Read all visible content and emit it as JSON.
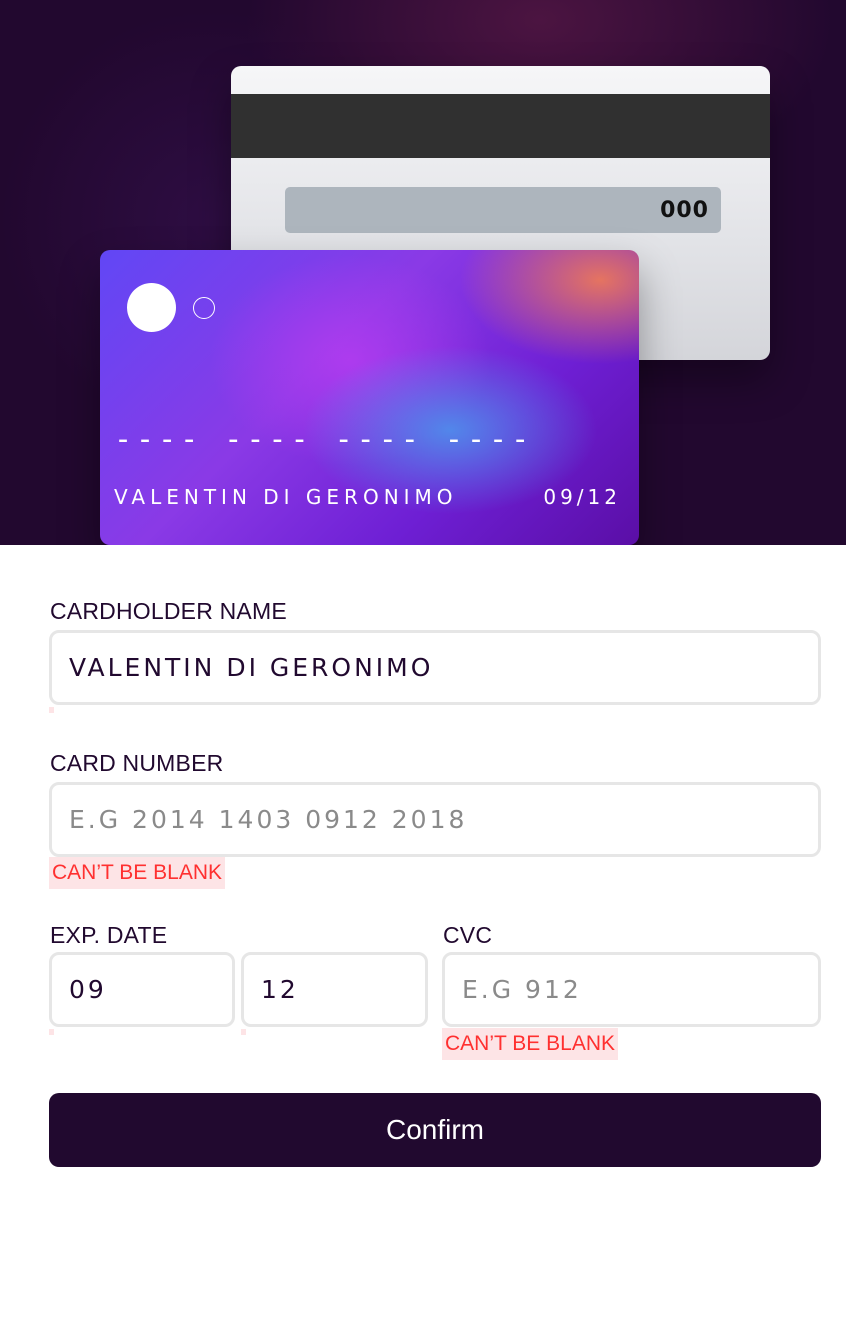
{
  "card": {
    "back": {
      "cvc": "000"
    },
    "front": {
      "number": "---- ---- ---- ----",
      "holder": "VALENTIN DI GERONIMO",
      "expiry": "09/12"
    }
  },
  "form": {
    "cardholder": {
      "label": "CARDHOLDER NAME",
      "value": "VALENTIN DI GERONIMO"
    },
    "number": {
      "label": "CARD NUMBER",
      "value": "",
      "placeholder": "E.G 2014 1403 0912 2018",
      "error": "CAN’T BE BLANK"
    },
    "expiry": {
      "label": "EXP. DATE",
      "month": "09",
      "year": "12"
    },
    "cvc": {
      "label": "CVC",
      "value": "",
      "placeholder": "E.G 912",
      "error": "CAN’T BE BLANK"
    },
    "confirm_label": "Confirm"
  },
  "colors": {
    "dark_violet": "#21092f",
    "error_red": "#ff3030",
    "error_bg": "#fde4e6",
    "input_border": "#e6e6e6"
  }
}
